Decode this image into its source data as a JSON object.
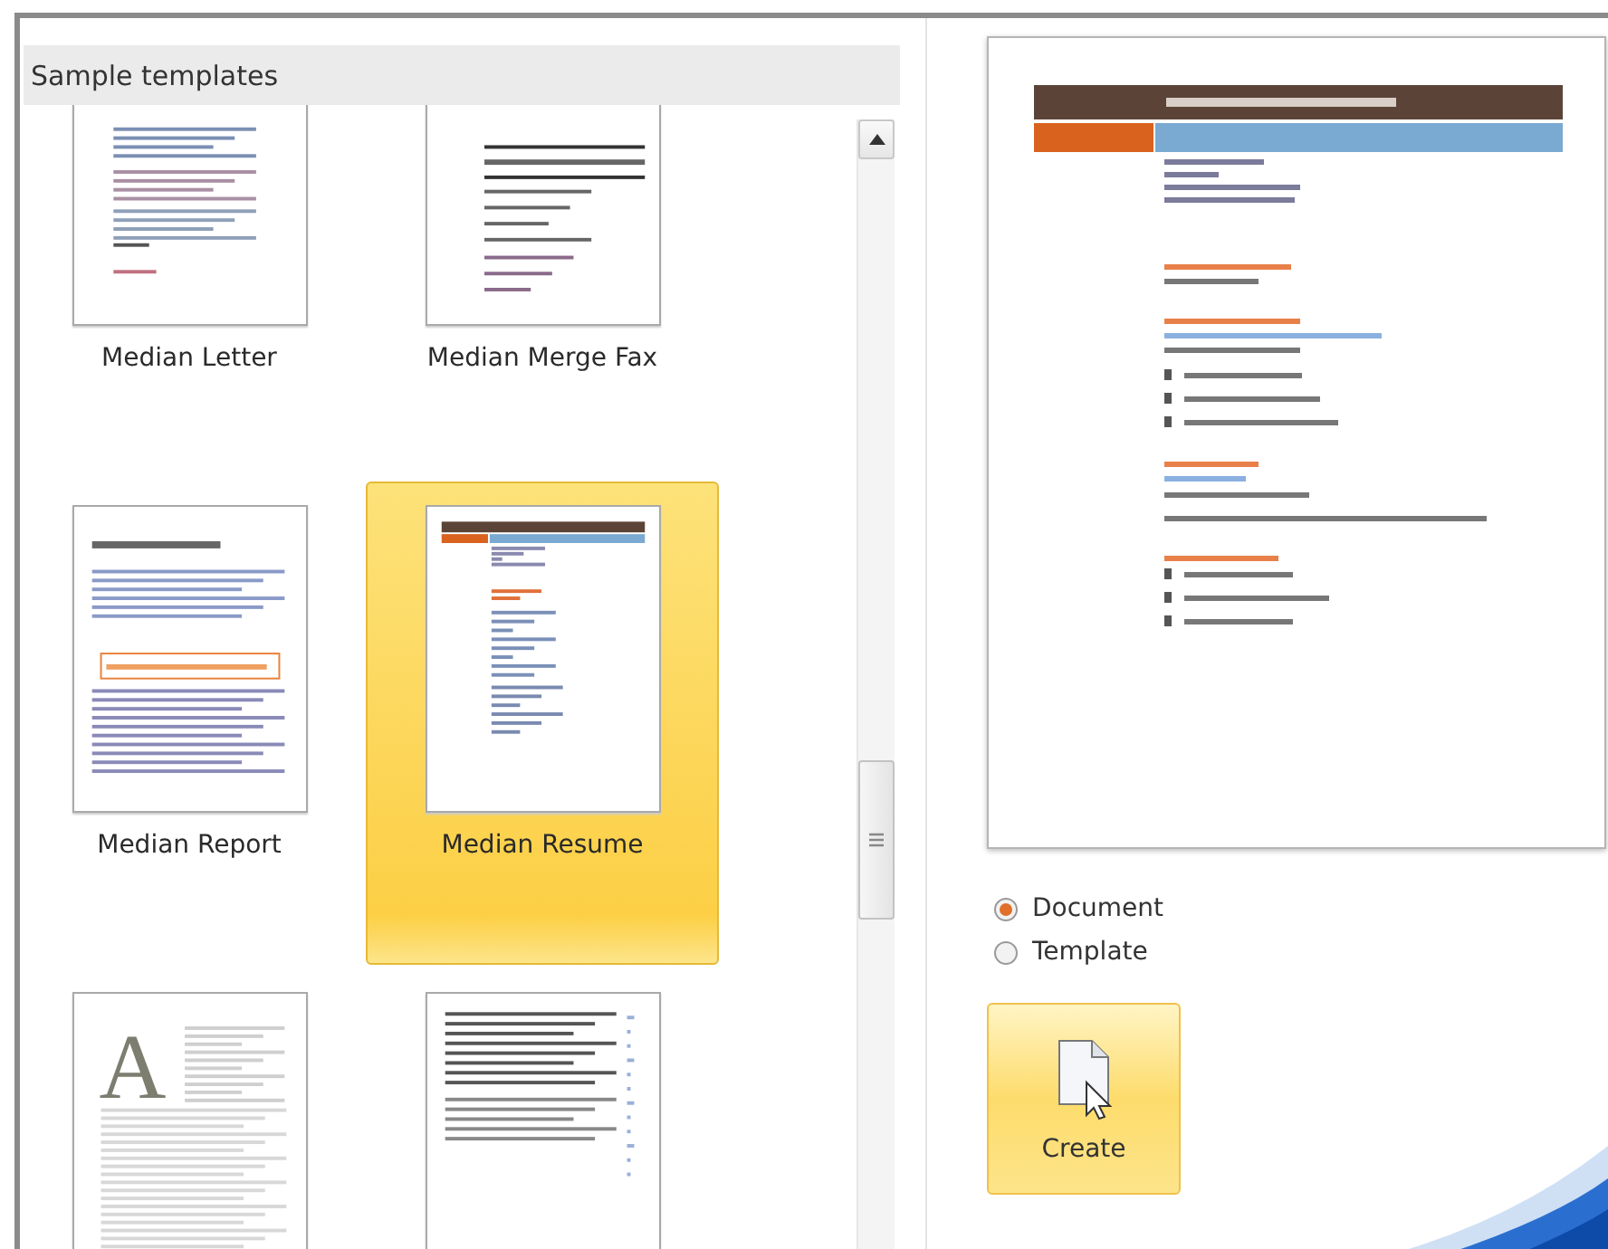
{
  "gallery": {
    "title": "Sample templates",
    "templates": [
      {
        "kind": "letter",
        "label": "Median Letter",
        "selected": false
      },
      {
        "kind": "fax",
        "label": "Median Merge Fax",
        "selected": false
      },
      {
        "kind": "report",
        "label": "Median Report",
        "selected": false
      },
      {
        "kind": "resume",
        "label": "Median Resume",
        "selected": true
      },
      {
        "kind": "cover",
        "initial": "A",
        "selected": false
      },
      {
        "kind": "list",
        "selected": false
      }
    ]
  },
  "create_as": [
    {
      "label": "Document",
      "selected": true
    },
    {
      "label": "Template",
      "selected": false
    }
  ],
  "create_button": {
    "label": "Create"
  }
}
